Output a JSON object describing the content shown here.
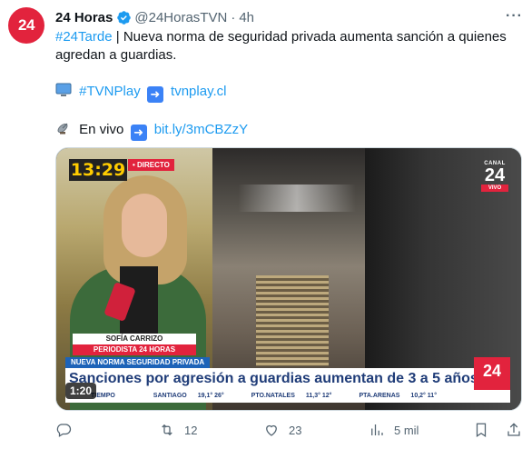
{
  "tweet": {
    "avatar_text": "24",
    "display_name": "24 Horas",
    "handle": "@24HorasTVN",
    "separator": "·",
    "time": "4h",
    "more": "···",
    "hashtag": "#24Tarde",
    "pipe": "|",
    "body": "Nueva norma de seguridad privada aumenta sanción a quienes agredan a guardias.",
    "line2_hashtag": "#TVNPlay",
    "line2_link": "tvnplay.cl",
    "line3_label": "En vivo",
    "line3_link": "bit.ly/3mCBZzY"
  },
  "media": {
    "clock": "13:29",
    "live_tag": "• DIRECTO",
    "channel_small": "CANAL",
    "channel_num": "24",
    "channel_vivo": "VIVO",
    "reporter_name": "SOFÍA CARRIZO",
    "reporter_role": "PERIODISTA 24 HORAS",
    "section_tag": "NUEVA NORMA SEGURIDAD PRIVADA",
    "headline": "Sanciones por agresión a guardias aumentan de 3 a 5 años",
    "lower_logo": "24",
    "ticker": [
      {
        "city": "TIEMPO",
        "temp": ""
      },
      {
        "city": "SANTIAGO",
        "temp": "19,1° 26°"
      },
      {
        "city": "PTO.NATALES",
        "temp": "11,3° 12°"
      },
      {
        "city": "PTA.ARENAS",
        "temp": "10,2° 11°"
      }
    ],
    "duration": "1:20"
  },
  "actions": {
    "reply_count": "",
    "retweet_count": "12",
    "like_count": "23",
    "views_count": "5 mil"
  },
  "colors": {
    "accent": "#1d9bf0",
    "brand_red": "#e2233d",
    "muted": "#536471"
  }
}
